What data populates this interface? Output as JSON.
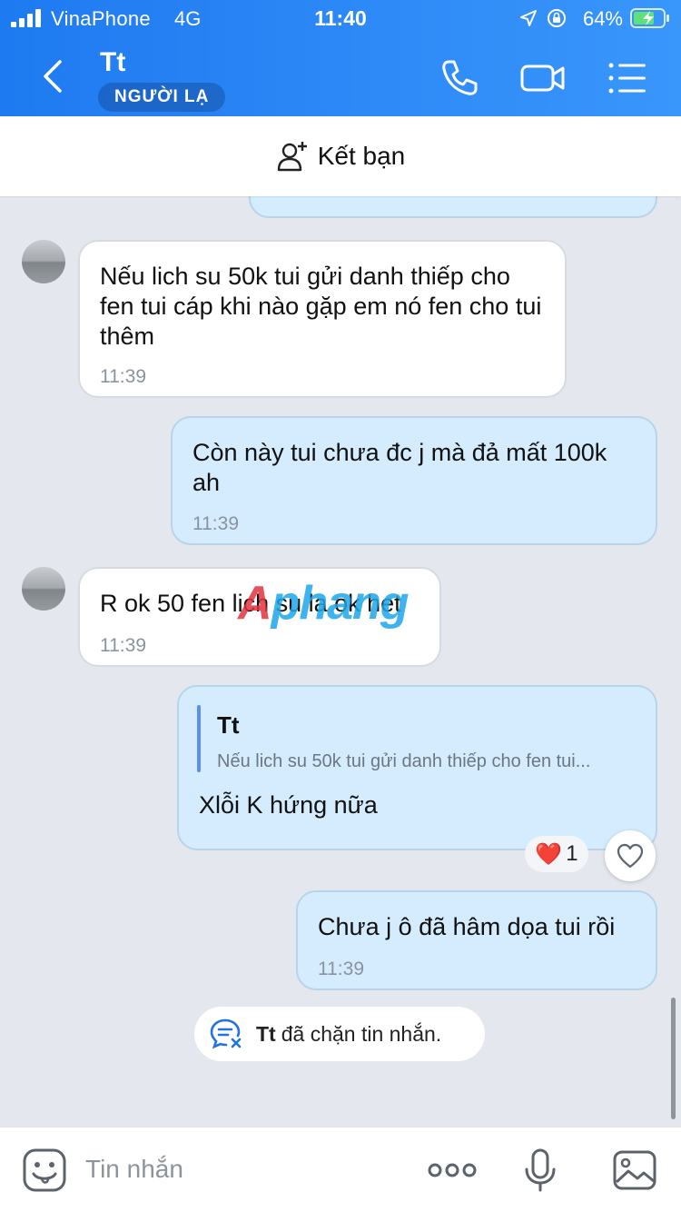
{
  "status_bar": {
    "carrier": "VinaPhone",
    "network": "4G",
    "time": "11:40",
    "battery": "64%"
  },
  "header": {
    "title": "Tt",
    "badge": "NGƯỜI LẠ"
  },
  "friend_bar": {
    "label": "Kết bạn"
  },
  "messages": [
    {
      "direction": "in",
      "text": "Nếu lich su 50k tui gửi danh thiếp cho fen tui cáp khi nào gặp em nó fen cho tui thêm",
      "time": "11:39"
    },
    {
      "direction": "out",
      "text": "Còn này tui chưa đc j mà đả mất 100k ah",
      "time": "11:39"
    },
    {
      "direction": "in",
      "text": "R ok 50 fen lich su la ok het",
      "time": "11:39"
    },
    {
      "direction": "out",
      "quote_name": "Tt",
      "quote_text": "Nếu lich su 50k tui gửi danh thiếp cho fen tui...",
      "text": "Xlỗi K hứng nữa"
    },
    {
      "direction": "out",
      "text": "Chưa j ô đã hâm dọa tui rồi",
      "time": "11:39"
    }
  ],
  "reaction": {
    "emoji": "❤️",
    "count": "1"
  },
  "watermark": {
    "part1": "A",
    "part2": "phang"
  },
  "notice": {
    "name": "Tt",
    "text": "đã chặn tin nhắn."
  },
  "composer": {
    "placeholder": "Tin nhắn"
  },
  "colors": {
    "header_blue": "#2f8bf7",
    "outgoing_bubble": "#d4ecfd",
    "incoming_bubble": "#ffffff"
  }
}
